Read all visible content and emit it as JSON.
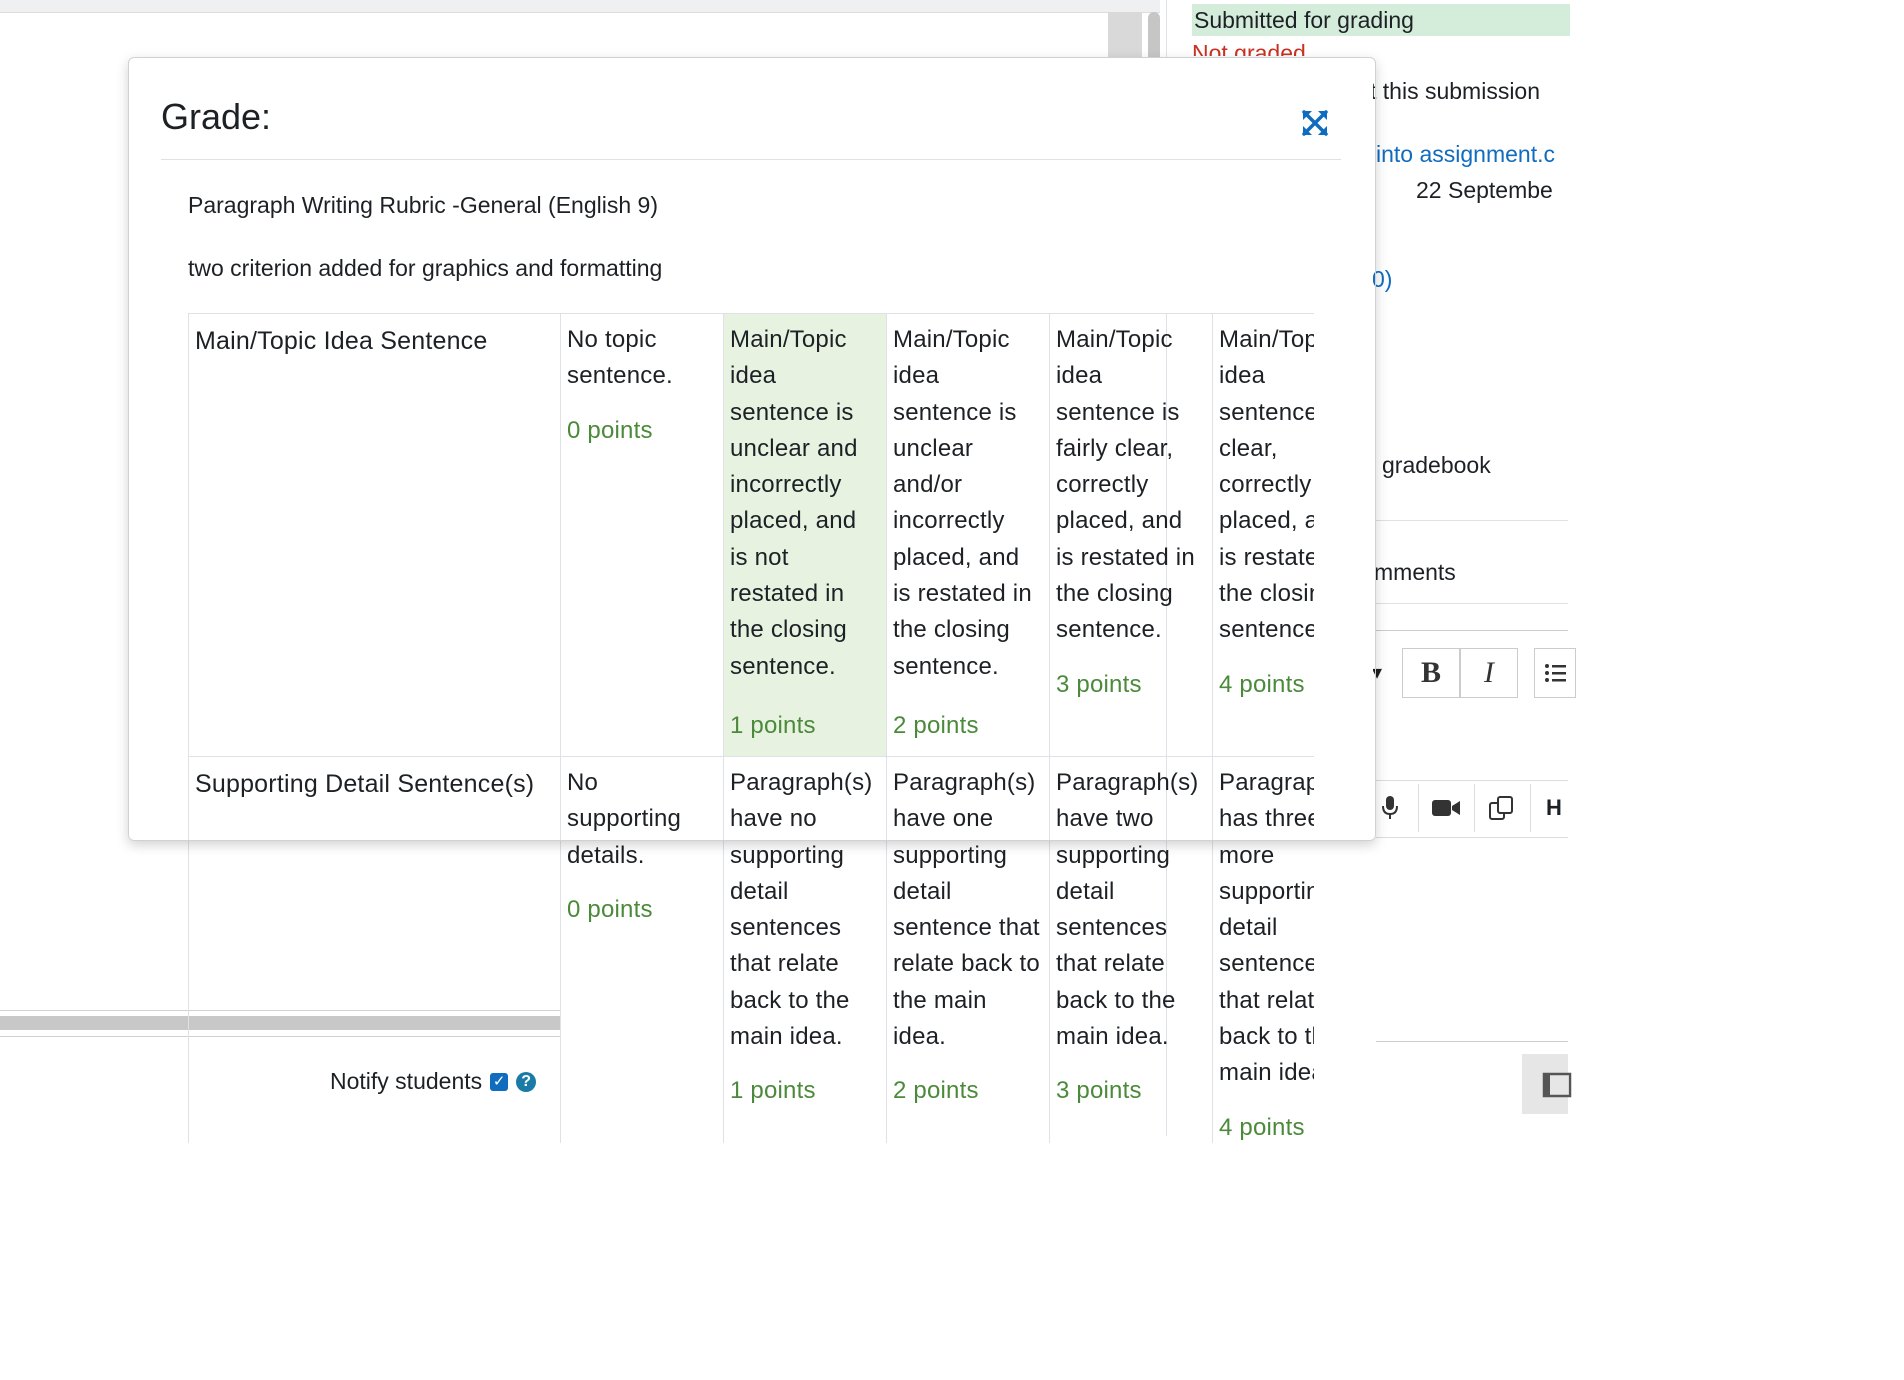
{
  "background": {
    "status_submitted": "Submitted for grading",
    "status_not_graded": "Not graded",
    "lock_submission_text": "t this submission",
    "assignment_link": "into assignment.c",
    "due_date_text": "22 Septembe",
    "files_link": "0)",
    "gradebook_text": "gradebook",
    "comments_text": "mments",
    "bold_label": "B",
    "italic_label": "I",
    "notify_students_label": "Notify students",
    "help_label": "?"
  },
  "modal": {
    "title": "Grade:",
    "rubric_name": "Paragraph Writing Rubric -General (English 9)",
    "rubric_description": "two criterion added for graphics and formatting"
  },
  "rubric": {
    "criteria": [
      {
        "name": "Main/Topic Idea Sentence",
        "levels": [
          {
            "text": "No topic sentence.",
            "points": "0 points"
          },
          {
            "text": "Main/Topic idea sentence is unclear and incorrectly placed, and is not restated in the closing sentence.",
            "points": "1 points"
          },
          {
            "text": "Main/Topic idea sentence is unclear and/or incorrectly placed, and is restated in the closing sentence.",
            "points": "2 points"
          },
          {
            "text": "Main/Topic idea sentence is fairly clear, correctly placed, and is restated in the closing sentence.",
            "points": "3 points"
          },
          {
            "text": "Main/Topic idea sentence is clear, correctly placed, and is restated in the closing sentence.",
            "points": "4 points"
          }
        ]
      },
      {
        "name": "Supporting Detail Sentence(s)",
        "levels": [
          {
            "text": "No supporting details.",
            "points": "0 points"
          },
          {
            "text": "Paragraph(s) have no supporting detail sentences that relate back to the main idea.",
            "points": "1 points"
          },
          {
            "text": "Paragraph(s) have one supporting detail sentence that relate back to the main idea.",
            "points": "2 points"
          },
          {
            "text": "Paragraph(s) have two supporting detail sentences that relate back to the main idea.",
            "points": "3 points"
          },
          {
            "text": "Paragraph(s) has three or more supporting detail sentences that relate back to the main idea.",
            "points": "4 points"
          }
        ]
      }
    ]
  },
  "colors": {
    "selected_level": "#e7f2e1",
    "points_text": "#4b8a3a",
    "link": "#0f6cbf",
    "submitted_bg": "#d4edda",
    "not_graded": "#ca3120"
  },
  "icons": [
    "expand-icon",
    "microphone-icon",
    "video-icon",
    "copy-icon",
    "checkbox-icon",
    "help-icon"
  ]
}
